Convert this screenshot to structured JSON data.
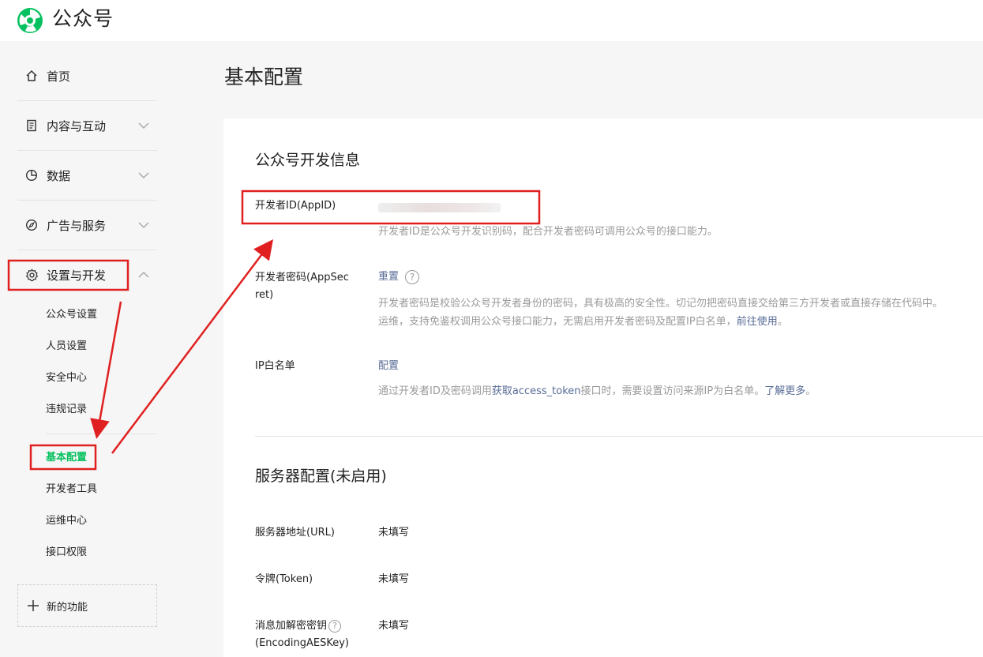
{
  "app": {
    "title": "公众号",
    "accent": "#07c160",
    "link_color": "#576b95",
    "annotation_color": "#e02020"
  },
  "sidebar": {
    "items": [
      {
        "label": "首页",
        "icon": "home-icon"
      },
      {
        "label": "内容与互动",
        "icon": "document-icon"
      },
      {
        "label": "数据",
        "icon": "pie-chart-icon"
      },
      {
        "label": "广告与服务",
        "icon": "compass-icon"
      },
      {
        "label": "设置与开发",
        "icon": "gear-icon"
      }
    ],
    "subitems": [
      "公众号设置",
      "人员设置",
      "安全中心",
      "违规记录",
      "基本配置",
      "开发者工具",
      "运维中心",
      "接口权限"
    ],
    "new_feature": "新的功能"
  },
  "main": {
    "title": "基本配置",
    "dev_info": {
      "title": "公众号开发信息",
      "appid_label": "开发者ID(AppID)",
      "appid_desc": "开发者ID是公众号开发识别码，配合开发者密码可调用公众号的接口能力。",
      "secret_label_1": "开发者密码(AppSec",
      "secret_label_2": "ret)",
      "secret_action": "重置",
      "secret_desc_1": "开发者密码是校验公众号开发者身份的密码，具有极高的安全性。切记勿把密码直接交给第三方开发者或直接存储在代码中。",
      "secret_desc_2a": "运维，支持免鉴权调用公众号接口能力，无需启用开发者密码及配置IP白名单，",
      "secret_desc_2_link": "前往使用",
      "secret_desc_2b": "。",
      "ip_label": "IP白名单",
      "ip_action": "配置",
      "ip_desc_a": "通过开发者ID及密码调用",
      "ip_desc_link1": "获取access_token",
      "ip_desc_b": "接口时，需要设置访问来源IP为白名单。",
      "ip_desc_link2": "了解更多",
      "ip_desc_c": "。"
    },
    "server": {
      "title": "服务器配置(未启用)",
      "url_label": "服务器地址(URL)",
      "url_value": "未填写",
      "token_label": "令牌(Token)",
      "token_value": "未填写",
      "aes_label_1": "消息加解密密钥",
      "aes_label_2": "(EncodingAESKey)",
      "aes_value": "未填写"
    }
  }
}
